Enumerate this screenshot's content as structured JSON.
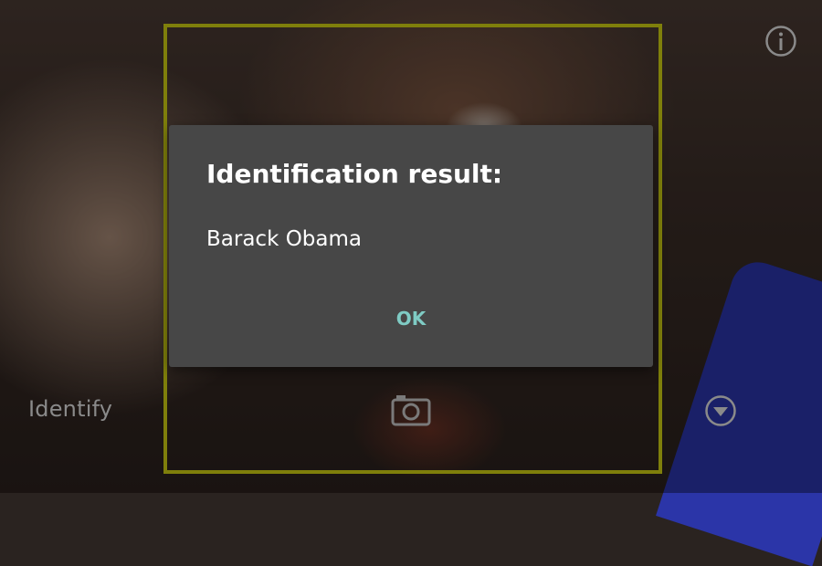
{
  "camera": {
    "identify_label": "Identify",
    "icons": {
      "capture": "camera-icon",
      "info": "info-icon",
      "menu": "chevron-down-circle-icon"
    },
    "colors": {
      "frame": "#7f7f0b",
      "dialog_background": "#474747",
      "accent": "#7fcbc4"
    }
  },
  "dialog": {
    "title": "Identification result:",
    "message": "Barack Obama",
    "ok_label": "OK"
  }
}
